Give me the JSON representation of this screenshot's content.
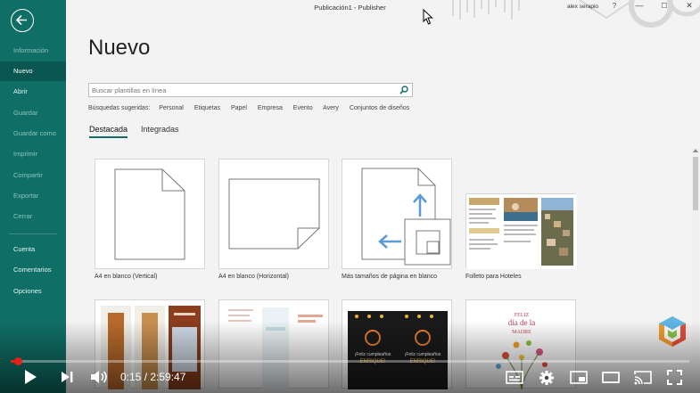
{
  "app": {
    "title": "Publicación1  -  Publisher",
    "user": "alex serapio",
    "window_controls": {
      "help": "?",
      "minimize": "—",
      "maximize": "☐",
      "close": "✕"
    }
  },
  "sidebar": {
    "items": [
      {
        "label": "Información",
        "state": "dim"
      },
      {
        "label": "Nuevo",
        "state": "active"
      },
      {
        "label": "Abrir",
        "state": "normal"
      },
      {
        "label": "Guardar",
        "state": "dim"
      },
      {
        "label": "Guardar como",
        "state": "dim"
      },
      {
        "label": "Imprimir",
        "state": "dim"
      },
      {
        "label": "Compartir",
        "state": "dim"
      },
      {
        "label": "Exportar",
        "state": "dim"
      },
      {
        "label": "Cerrar",
        "state": "dim"
      },
      {
        "label": "Cuenta",
        "state": "normal"
      },
      {
        "label": "Comentarios",
        "state": "normal"
      },
      {
        "label": "Opciones",
        "state": "normal"
      }
    ]
  },
  "main": {
    "heading": "Nuevo",
    "search": {
      "placeholder": "Buscar plantillas en línea",
      "value": ""
    },
    "suggested": {
      "label": "Búsquedas sugeridas:",
      "items": [
        "Personal",
        "Etiquetas",
        "Papel",
        "Empresa",
        "Evento",
        "Avery",
        "Conjuntos de diseños"
      ]
    },
    "tabs": [
      {
        "label": "Destacada",
        "active": true
      },
      {
        "label": "Integradas",
        "active": false
      }
    ],
    "templates": [
      {
        "caption": "A4 en blanco (Vertical)"
      },
      {
        "caption": "A4 en blanco (Horizontal)"
      },
      {
        "caption": "Más tamaños de página en blanco"
      },
      {
        "caption": "Folleto para Hoteles"
      }
    ],
    "row2": {
      "card5_text": "¡Feliz cumpleaños ENRIQUE!",
      "card6_text": "FELIZ día de la MADRE"
    }
  },
  "player": {
    "time": "0:15 / 2:59:47",
    "progress": 0.0014,
    "colors": {
      "accent": "#e62117"
    }
  },
  "colors": {
    "sidebar": "#0f6f66",
    "sidebar_active": "#0a5650",
    "background": "#f3f3f3"
  }
}
